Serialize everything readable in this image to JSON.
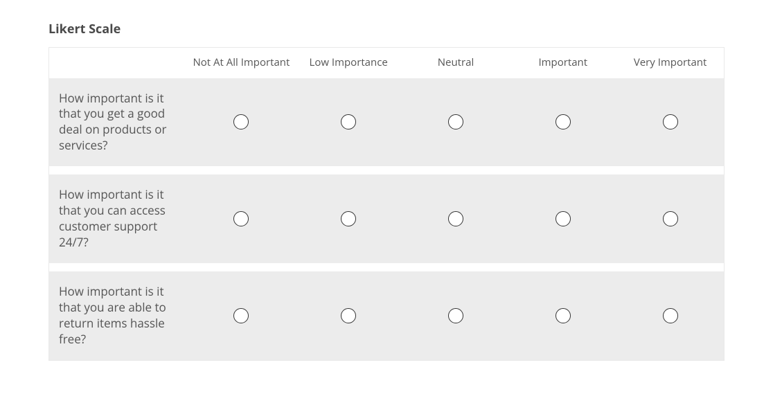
{
  "title": "Likert Scale",
  "columns": [
    "Not At All Important",
    "Low Importance",
    "Neutral",
    "Important",
    "Very Important"
  ],
  "questions": [
    "How important is it that you get a good deal on products or services?",
    "How important is it that you can access customer support 24/7?",
    "How important is it that you are able to return items hassle free?"
  ]
}
